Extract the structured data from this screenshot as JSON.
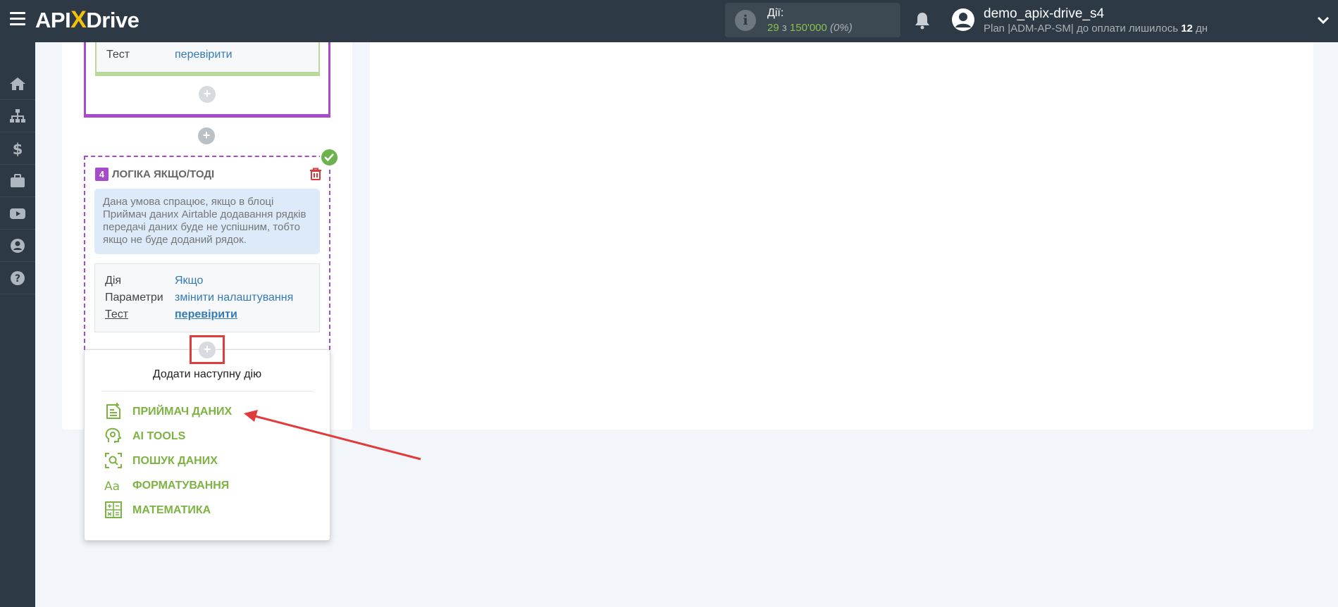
{
  "app": {
    "logo_left": "API",
    "logo_x": "X",
    "logo_right": "Drive"
  },
  "header": {
    "actions_label": "Дії:",
    "actions_used": "29",
    "actions_of": "з",
    "actions_total": "150'000",
    "actions_pct": "(0%)",
    "user_name": "demo_apix-drive_s4",
    "plan_text": "Plan |ADM-AP-SM| до оплати лишилось",
    "plan_days": "12",
    "plan_days_unit": "дн"
  },
  "sidebar": {
    "items": [
      "home-icon",
      "sitemap-icon",
      "dollar-icon",
      "briefcase-icon",
      "youtube-icon",
      "user-circle-icon",
      "help-icon"
    ]
  },
  "prev_block": {
    "test_label": "Тест",
    "test_link": "перевірити"
  },
  "logic_block": {
    "number": "4",
    "title": "ЛОГІКА ЯКЩО/ТОДІ",
    "description": "Дана умова спрацює, якщо в блоці Приймач даних Airtable додавання рядків передачі даних буде не успішним, тобто якщо не буде доданий рядок.",
    "action_label": "Дія",
    "action_value": "Якщо",
    "params_label": "Параметри",
    "params_value": "змінити налаштування",
    "test_label": "Тест",
    "test_value": "перевірити"
  },
  "plus_symbol": "+",
  "dropdown": {
    "title": "Додати наступну дію",
    "items": [
      {
        "label": "ПРИЙМАЧ ДАНИХ",
        "icon": "data-receiver-icon"
      },
      {
        "label": "AI TOOLS",
        "icon": "ai-head-icon"
      },
      {
        "label": "ПОШУК ДАНИХ",
        "icon": "search-data-icon"
      },
      {
        "label": "ФОРМАТУВАННЯ",
        "icon": "format-text-icon"
      },
      {
        "label": "МАТЕМАТИКА",
        "icon": "calculator-icon"
      }
    ]
  },
  "colors": {
    "accent_green": "#7cb342",
    "block_purple": "#a54bcb",
    "header_bg": "#2d3a45",
    "annotation_red": "#e03c3c"
  }
}
